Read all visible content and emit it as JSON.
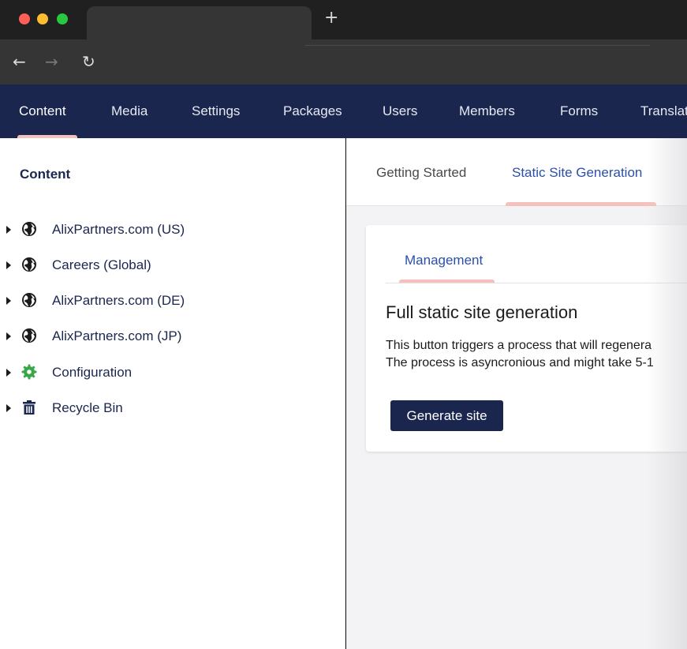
{
  "browser": {
    "new_tab_symbol": "+",
    "back_icon": "←",
    "forward_icon": "→",
    "reload_icon": "↻"
  },
  "header": {
    "menu": [
      {
        "label": "Content"
      },
      {
        "label": "Media"
      },
      {
        "label": "Settings"
      },
      {
        "label": "Packages"
      },
      {
        "label": "Users"
      },
      {
        "label": "Members"
      },
      {
        "label": "Forms"
      },
      {
        "label": "Translat"
      }
    ]
  },
  "sidebar": {
    "title": "Content",
    "items": [
      {
        "label": "AlixPartners.com (US)",
        "icon": "globe-icon"
      },
      {
        "label": "Careers (Global)",
        "icon": "globe-icon"
      },
      {
        "label": "AlixPartners.com (DE)",
        "icon": "globe-icon"
      },
      {
        "label": "AlixPartners.com (JP)",
        "icon": "globe-icon"
      },
      {
        "label": "Configuration",
        "icon": "gear-icon"
      },
      {
        "label": "Recycle Bin",
        "icon": "trash-icon"
      }
    ]
  },
  "main": {
    "tabs": [
      {
        "label": "Getting Started"
      },
      {
        "label": "Static Site Generation"
      }
    ],
    "card": {
      "tab_label": "Management",
      "heading": "Full static site generation",
      "description_line1": "This button triggers a process that will regenera",
      "description_line2": "The process is asyncronious and might take 5-1",
      "button_label": "Generate site"
    }
  },
  "colors": {
    "header_bg": "#1b264f",
    "accent_underline": "#f5c1bc",
    "link_blue": "#2b4fa8",
    "config_green": "#3aa64a"
  }
}
